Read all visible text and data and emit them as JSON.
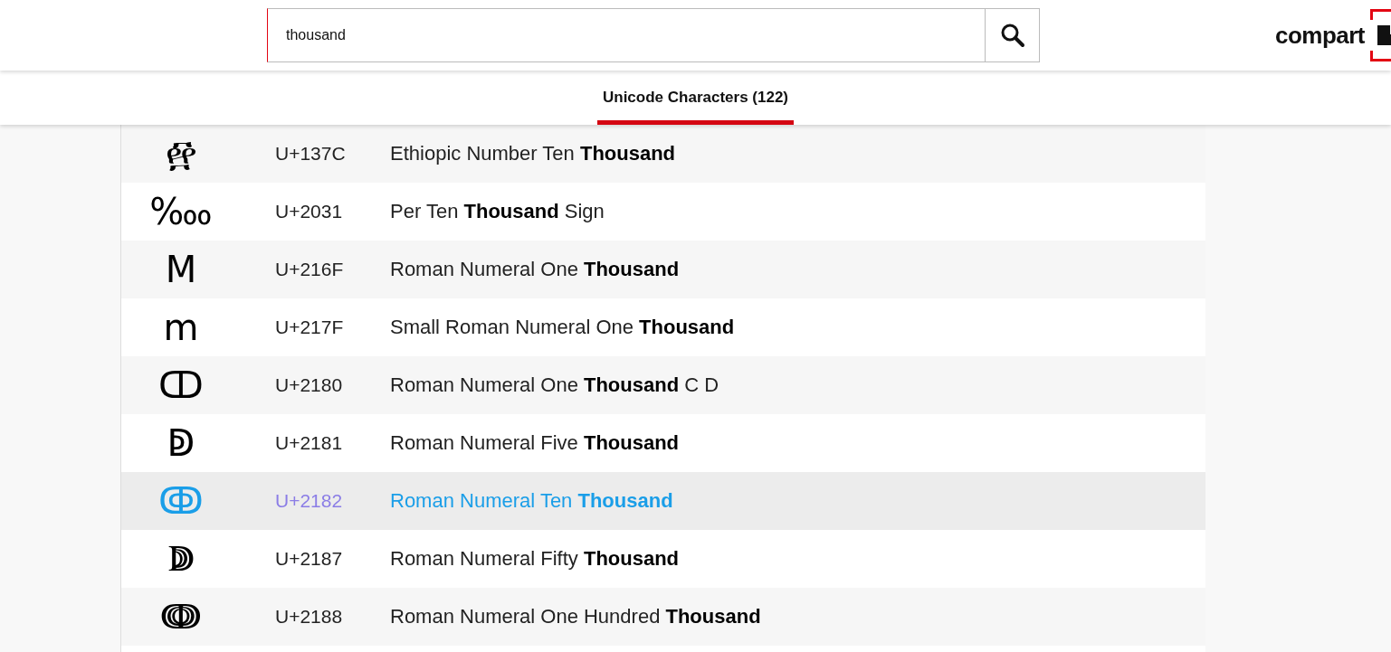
{
  "search": {
    "value": "thousand"
  },
  "logo": {
    "text": "compart"
  },
  "tabs": [
    {
      "label": "Unicode Characters (122)",
      "selected": true
    }
  ],
  "rows": [
    {
      "glyph": "፼",
      "code": "U+137C",
      "name": "Ethiopic Number Ten **Thousand**",
      "selected": false
    },
    {
      "glyph": "‱",
      "code": "U+2031",
      "name": "Per Ten **Thousand** Sign",
      "selected": false
    },
    {
      "glyph": "Ⅿ",
      "code": "U+216F",
      "name": "Roman Numeral One **Thousand**",
      "selected": false
    },
    {
      "glyph": "ⅿ",
      "code": "U+217F",
      "name": "Small Roman Numeral One **Thousand**",
      "selected": false
    },
    {
      "glyph": "ↀ",
      "code": "U+2180",
      "name": "Roman Numeral One **Thousand** C D",
      "selected": false
    },
    {
      "glyph": "ↁ",
      "code": "U+2181",
      "name": "Roman Numeral Five **Thousand**",
      "selected": false
    },
    {
      "glyph": "ↂ",
      "code": "U+2182",
      "name": "Roman Numeral Ten **Thousand**",
      "selected": true
    },
    {
      "glyph": "ↇ",
      "code": "U+2187",
      "name": "Roman Numeral Fifty **Thousand**",
      "selected": false
    },
    {
      "glyph": "ↈ",
      "code": "U+2188",
      "name": "Roman Numeral One Hundred **Thousand**",
      "selected": false
    }
  ]
}
